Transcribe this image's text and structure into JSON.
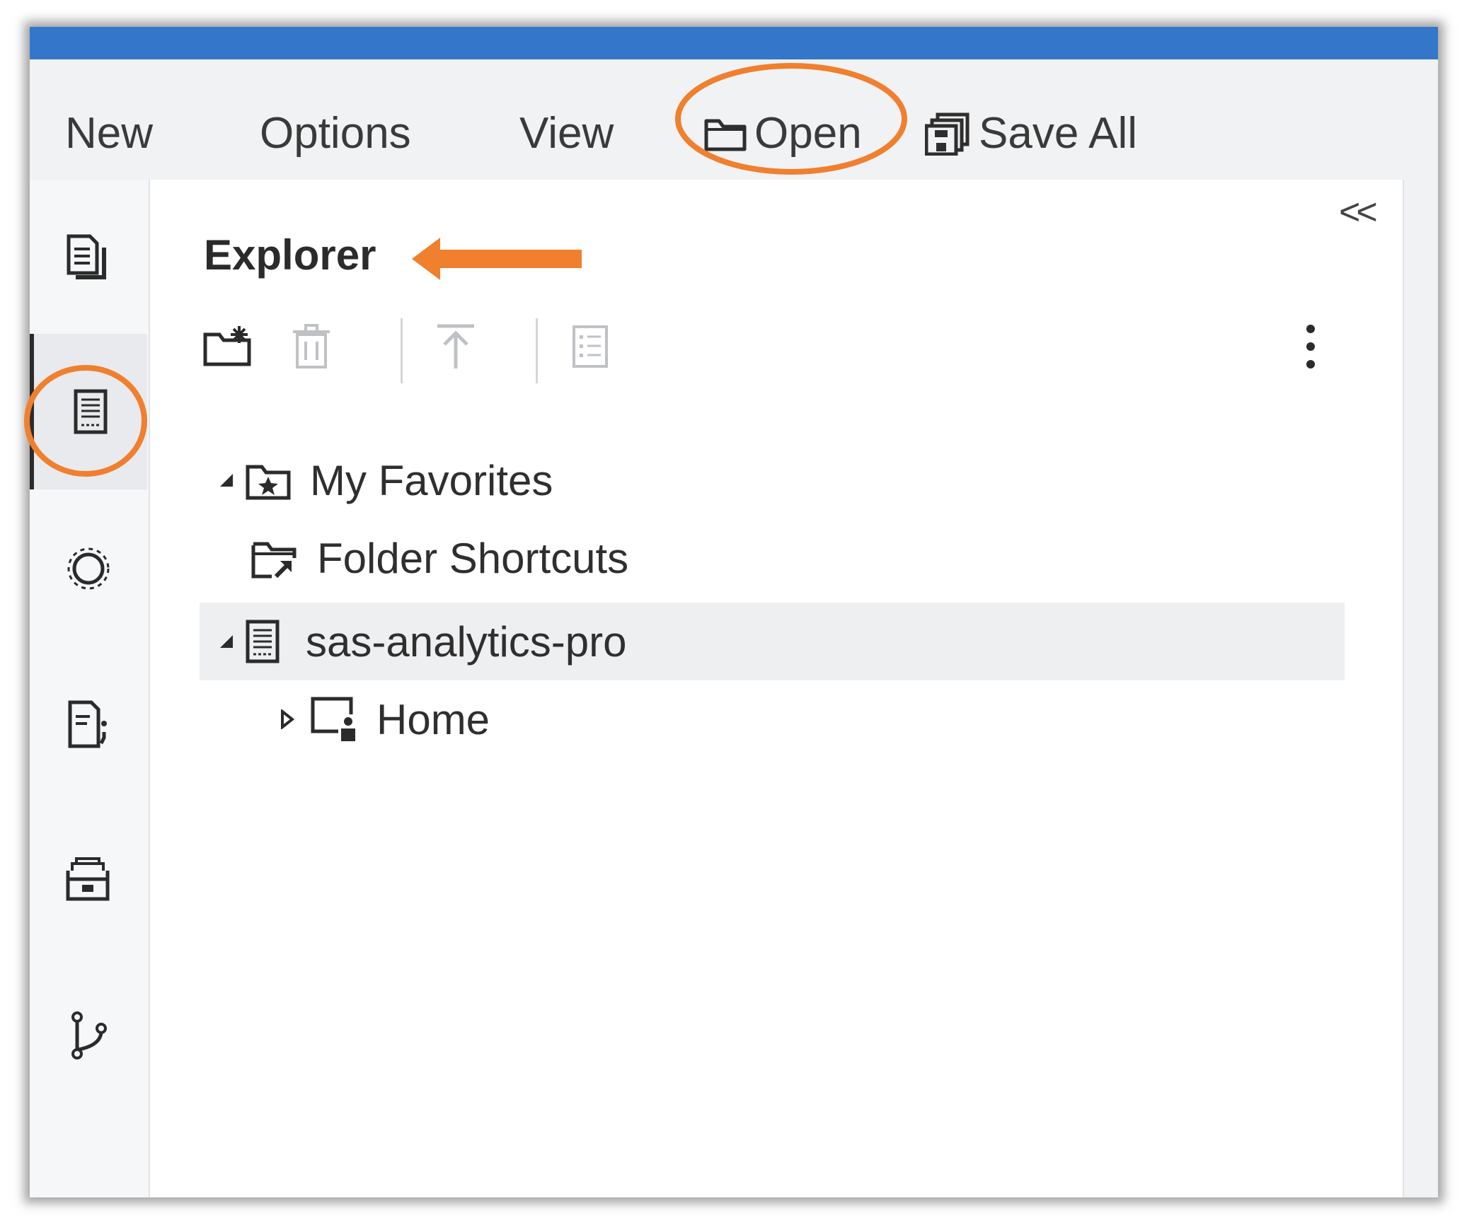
{
  "menubar": {
    "items": [
      {
        "label": "New",
        "icon": ""
      },
      {
        "label": "Options",
        "icon": ""
      },
      {
        "label": "View",
        "icon": ""
      },
      {
        "label": "Open",
        "icon": "folder-icon"
      },
      {
        "label": "Save All",
        "icon": "save-all-icon"
      }
    ]
  },
  "rail": {
    "items": [
      {
        "icon": "documents-icon",
        "active": false
      },
      {
        "icon": "server-icon",
        "active": true
      },
      {
        "icon": "target-icon",
        "active": false
      },
      {
        "icon": "code-snippet-icon",
        "active": false
      },
      {
        "icon": "library-icon",
        "active": false
      },
      {
        "icon": "git-branch-icon",
        "active": false
      }
    ]
  },
  "panel": {
    "title": "Explorer",
    "collapse_label": "<<",
    "toolbar": [
      {
        "icon": "new-folder-icon",
        "enabled": true
      },
      {
        "icon": "delete-icon",
        "enabled": false
      },
      {
        "icon": "upload-icon",
        "enabled": false
      },
      {
        "icon": "properties-icon",
        "enabled": false
      },
      {
        "icon": "more-options-icon",
        "enabled": true
      }
    ],
    "tree": [
      {
        "label": "My Favorites",
        "icon": "favorites-folder-icon",
        "expand": "expanded",
        "level": 0
      },
      {
        "label": "Folder Shortcuts",
        "icon": "folder-shortcut-icon",
        "expand": "none",
        "level": 0
      },
      {
        "label": "sas-analytics-pro",
        "icon": "server-icon",
        "expand": "expanded",
        "level": 0,
        "selected": true
      },
      {
        "label": "Home",
        "icon": "home-folder-icon",
        "expand": "collapsed",
        "level": 1
      }
    ]
  },
  "annotations": {
    "color": "#f07f2e"
  },
  "colors": {
    "titlebar": "#3476c9",
    "annotation": "#f07f2e"
  }
}
